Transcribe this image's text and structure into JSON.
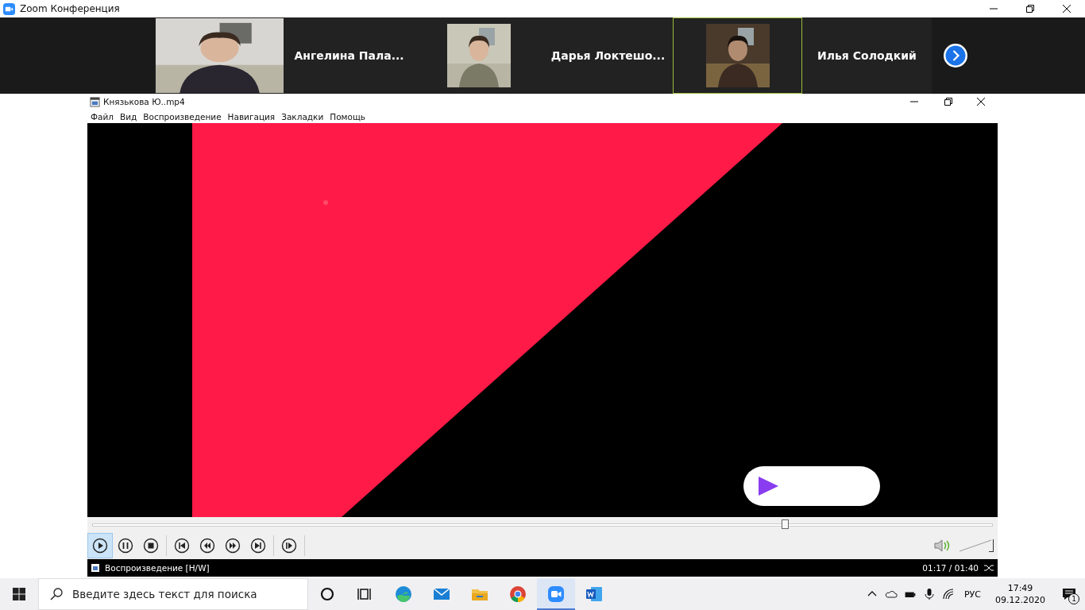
{
  "zoom_window": {
    "title": "Zoom Конференция"
  },
  "participants": [
    {
      "kind": "picture",
      "selected": false
    },
    {
      "kind": "name",
      "name": "Ангелина  Пала...",
      "selected": false
    },
    {
      "kind": "picture",
      "selected": false
    },
    {
      "kind": "name",
      "name": "Дарья  Локтешо...",
      "selected": false
    },
    {
      "kind": "picture",
      "selected": true
    },
    {
      "kind": "name",
      "name": "Илья Солодкий",
      "selected": false
    }
  ],
  "player": {
    "title": "Князькова Ю..mp4",
    "menu": [
      "Файл",
      "Вид",
      "Воспроизведение",
      "Навигация",
      "Закладки",
      "Помощь"
    ],
    "video": {
      "kind": "picture"
    },
    "seek": {
      "level": 0.77
    },
    "controls": [
      {
        "kind": "play",
        "selected": true
      },
      {
        "kind": "pause",
        "selected": false
      },
      {
        "kind": "stop",
        "selected": false
      },
      {
        "kind": "prev",
        "selected": false
      },
      {
        "kind": "rewind",
        "selected": false
      },
      {
        "kind": "forward",
        "selected": false
      },
      {
        "kind": "next",
        "selected": false
      },
      {
        "kind": "frame",
        "selected": false
      }
    ],
    "volume": {
      "level": 1
    },
    "status": "Воспроизведение [H/W]",
    "time": "01:17 / 01:40"
  },
  "taskbar": {
    "search": {
      "placeholder": "Введите здесь текст для поиска"
    },
    "apps": [
      {
        "kind": "cortana",
        "selected": false
      },
      {
        "kind": "taskview",
        "selected": false
      },
      {
        "kind": "edge",
        "selected": false
      },
      {
        "kind": "mail",
        "selected": false
      },
      {
        "kind": "folder",
        "selected": false
      },
      {
        "kind": "chrome",
        "selected": false
      },
      {
        "kind": "zoom",
        "selected": true
      },
      {
        "kind": "word",
        "selected": false
      }
    ],
    "language": "РУС",
    "time": "17:49",
    "date": "09.12.2020",
    "notifications": "1"
  }
}
